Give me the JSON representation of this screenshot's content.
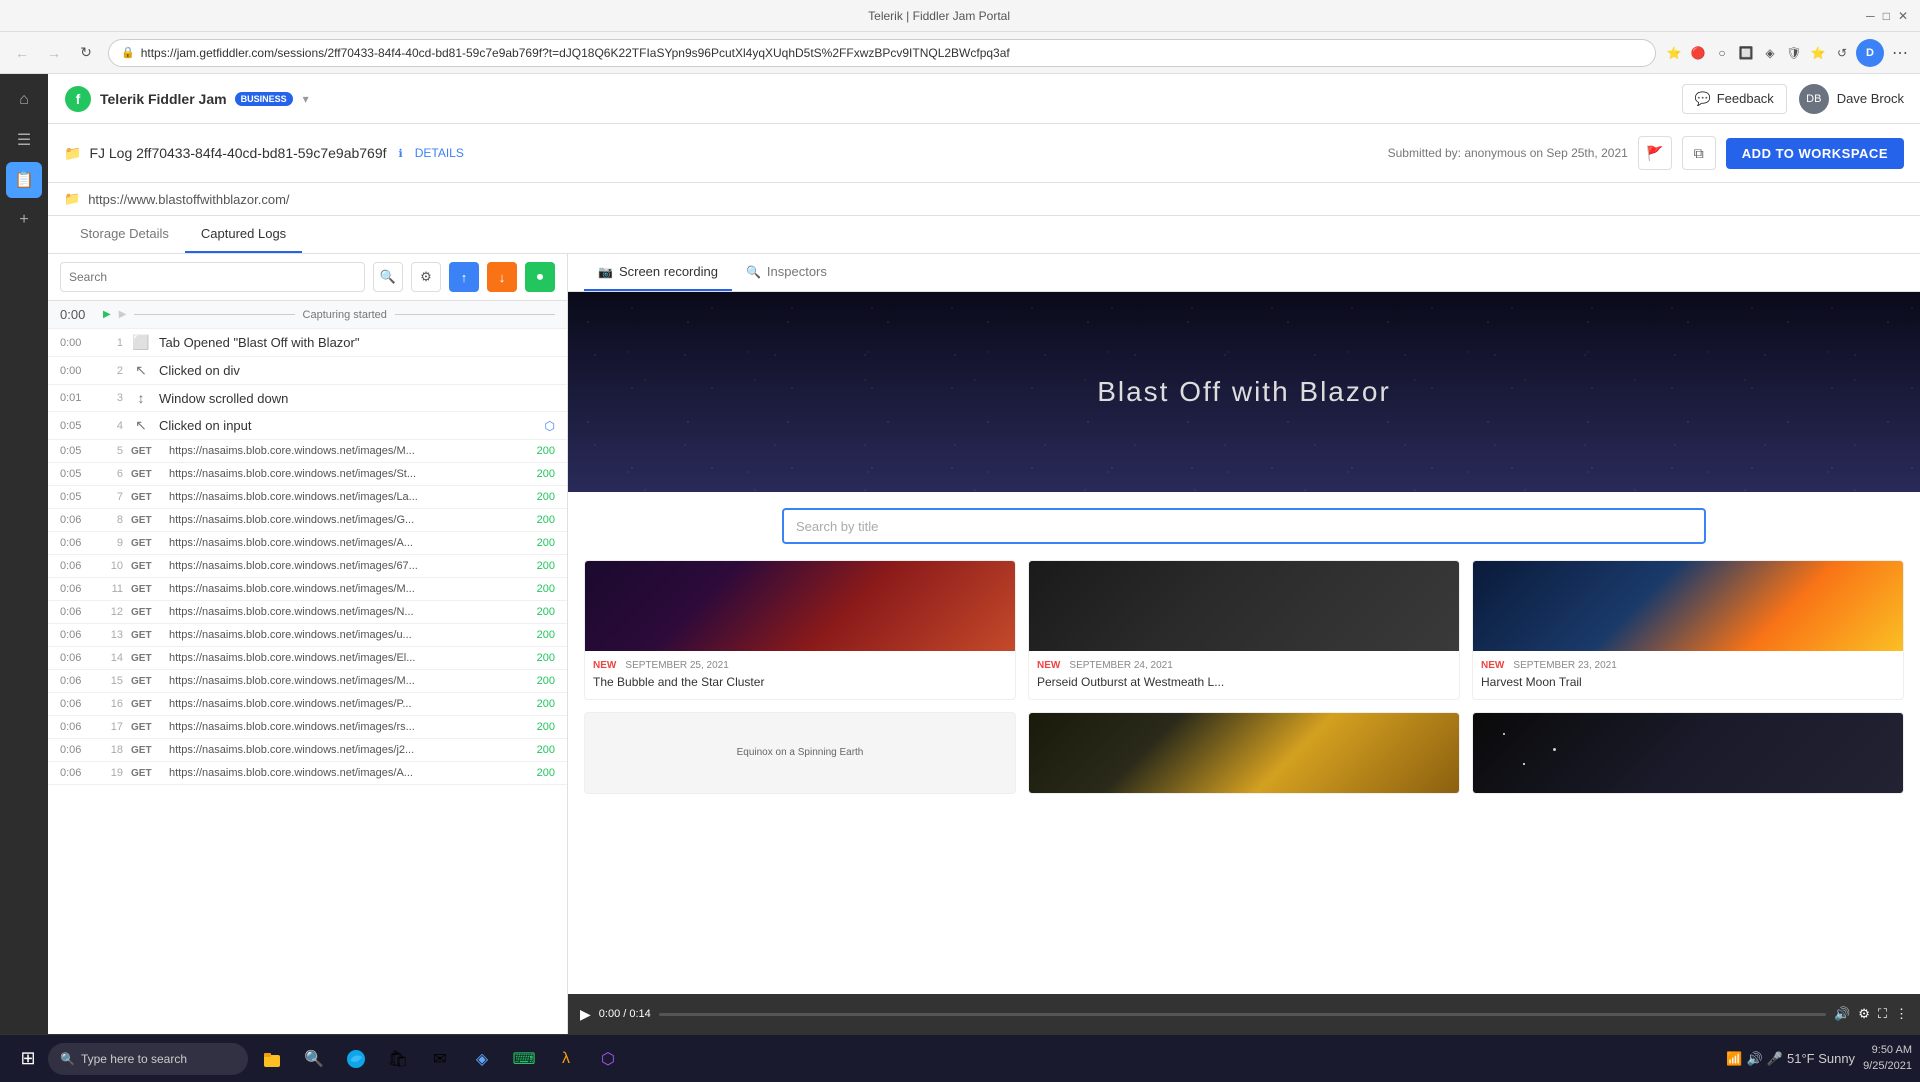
{
  "browser": {
    "title": "Telerik | Fiddler Jam Portal",
    "url": "https://jam.getfiddler.com/sessions/2ff70433-84f4-40cd-bd81-59c7e9ab769f?t=dJQ18Q6K22TFIaSYpn9s96PcutXl4yqXUqhD5tS%2FFxwzBPcv9ITNQL2BWcfpq3af",
    "nav": {
      "back": "←",
      "forward": "→",
      "refresh": "↻"
    }
  },
  "app": {
    "logo_text": "Telerik Fiddler Jam",
    "badge": "BUSINESS",
    "feedback_btn": "Feedback",
    "user_name": "Dave Brock"
  },
  "log_header": {
    "folder_icon": "📁",
    "title": "FJ Log 2ff70433-84f4-40cd-bd81-59c7e9ab769f",
    "details_label": "DETAILS",
    "submitted_text": "Submitted by: anonymous on Sep 25th, 2021",
    "add_workspace_label": "ADD TO WORKSPACE"
  },
  "url_bar": {
    "url": "https://www.blastoffwithblazor.com/"
  },
  "tabs": {
    "storage": "Storage Details",
    "captured": "Captured Logs"
  },
  "toolbar": {
    "search_placeholder": "Search",
    "filter_label": "Filter",
    "import_label": "Import",
    "export_label": "Export",
    "record_label": "Record"
  },
  "capture_row": {
    "time": "0:00",
    "label": "Capturing started"
  },
  "log_rows": [
    {
      "time": "0:00",
      "num": "1",
      "icon": "tab",
      "action": "Tab Opened \"Blast Off with Blazor\"",
      "method": null,
      "url": null,
      "status": null
    },
    {
      "time": "0:00",
      "num": "2",
      "icon": "cursor",
      "action": "Clicked on div",
      "method": null,
      "url": null,
      "status": null,
      "has_export": false
    },
    {
      "time": "0:01",
      "num": "3",
      "icon": "scroll",
      "action": "Window scrolled down",
      "method": null,
      "url": null,
      "status": null,
      "has_export": false
    },
    {
      "time": "0:05",
      "num": "4",
      "icon": "cursor",
      "action": "Clicked on input",
      "method": null,
      "url": null,
      "status": null,
      "has_export": true
    },
    {
      "time": "0:05",
      "num": "5",
      "icon": null,
      "action": null,
      "method": "GET",
      "url": "https://nasaims.blob.core.windows.net/images/M...",
      "status": "200"
    },
    {
      "time": "0:05",
      "num": "6",
      "icon": null,
      "action": null,
      "method": "GET",
      "url": "https://nasaims.blob.core.windows.net/images/St...",
      "status": "200"
    },
    {
      "time": "0:05",
      "num": "7",
      "icon": null,
      "action": null,
      "method": "GET",
      "url": "https://nasaims.blob.core.windows.net/images/La...",
      "status": "200"
    },
    {
      "time": "0:06",
      "num": "8",
      "icon": null,
      "action": null,
      "method": "GET",
      "url": "https://nasaims.blob.core.windows.net/images/G...",
      "status": "200"
    },
    {
      "time": "0:06",
      "num": "9",
      "icon": null,
      "action": null,
      "method": "GET",
      "url": "https://nasaims.blob.core.windows.net/images/A...",
      "status": "200"
    },
    {
      "time": "0:06",
      "num": "10",
      "icon": null,
      "action": null,
      "method": "GET",
      "url": "https://nasaims.blob.core.windows.net/images/67...",
      "status": "200"
    },
    {
      "time": "0:06",
      "num": "11",
      "icon": null,
      "action": null,
      "method": "GET",
      "url": "https://nasaims.blob.core.windows.net/images/M...",
      "status": "200"
    },
    {
      "time": "0:06",
      "num": "12",
      "icon": null,
      "action": null,
      "method": "GET",
      "url": "https://nasaims.blob.core.windows.net/images/N...",
      "status": "200"
    },
    {
      "time": "0:06",
      "num": "13",
      "icon": null,
      "action": null,
      "method": "GET",
      "url": "https://nasaims.blob.core.windows.net/images/u...",
      "status": "200"
    },
    {
      "time": "0:06",
      "num": "14",
      "icon": null,
      "action": null,
      "method": "GET",
      "url": "https://nasaims.blob.core.windows.net/images/El...",
      "status": "200"
    },
    {
      "time": "0:06",
      "num": "15",
      "icon": null,
      "action": null,
      "method": "GET",
      "url": "https://nasaims.blob.core.windows.net/images/M...",
      "status": "200"
    },
    {
      "time": "0:06",
      "num": "16",
      "icon": null,
      "action": null,
      "method": "GET",
      "url": "https://nasaims.blob.core.windows.net/images/P...",
      "status": "200"
    },
    {
      "time": "0:06",
      "num": "17",
      "icon": null,
      "action": null,
      "method": "GET",
      "url": "https://nasaims.blob.core.windows.net/images/rs...",
      "status": "200"
    },
    {
      "time": "0:06",
      "num": "18",
      "icon": null,
      "action": null,
      "method": "GET",
      "url": "https://nasaims.blob.core.windows.net/images/j2...",
      "status": "200"
    },
    {
      "time": "0:06",
      "num": "19",
      "icon": null,
      "action": null,
      "method": "GET",
      "url": "https://nasaims.blob.core.windows.net/images/A...",
      "status": "200"
    }
  ],
  "recording_panel": {
    "screen_recording_tab": "Screen recording",
    "inspectors_tab": "Inspectors",
    "site_title": "Blast Off with Blazor",
    "search_placeholder": "Search by title",
    "articles": [
      {
        "badge": "NEW",
        "date": "SEPTEMBER 25, 2021",
        "title": "The Bubble and the Star Cluster",
        "img_type": "nebula"
      },
      {
        "badge": "NEW",
        "date": "SEPTEMBER 24, 2021",
        "title": "Perseid Outburst at Westmeath L...",
        "img_type": "meteor"
      },
      {
        "badge": "NEW",
        "date": "SEPTEMBER 23, 2021",
        "title": "Harvest Moon Trail",
        "img_type": "bridge"
      }
    ],
    "bottom_cards": [
      {
        "text": "Equinox on a Spinning Earth",
        "img_type": "equinox"
      },
      {
        "img_type": "moon"
      },
      {
        "img_type": "stars"
      }
    ],
    "video_time": "0:00 / 0:14"
  },
  "taskbar": {
    "search_placeholder": "Type here to search",
    "time": "9:50 AM",
    "date": "9/25/2021",
    "weather": "51°F Sunny"
  }
}
